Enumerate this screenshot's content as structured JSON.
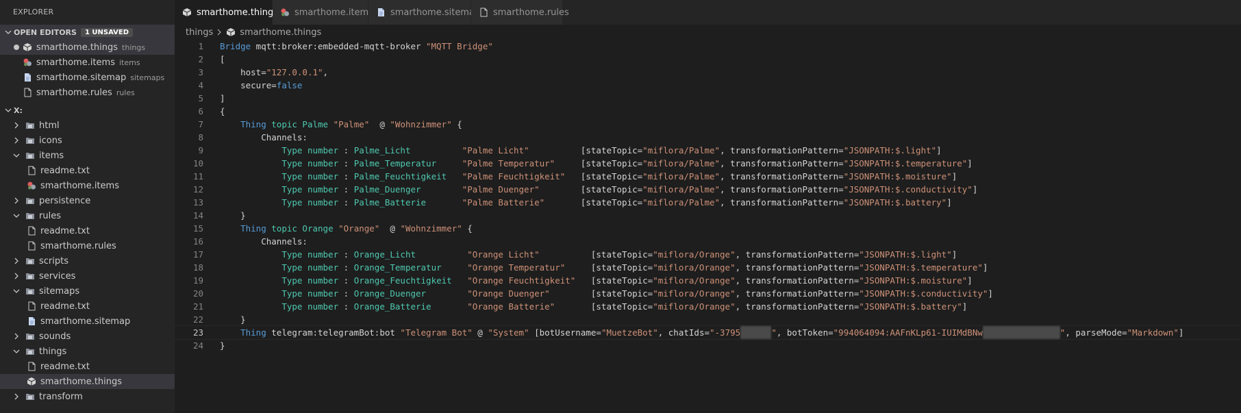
{
  "sidebar": {
    "title": "EXPLORER",
    "open_editors": {
      "label": "OPEN EDITORS",
      "badge": "1 UNSAVED",
      "items": [
        {
          "name": "smarthome.things",
          "desc": "things",
          "icon": "things-file-icon"
        },
        {
          "name": "smarthome.items",
          "desc": "items",
          "icon": "items-file-icon"
        },
        {
          "name": "smarthome.sitemap",
          "desc": "sitemaps",
          "icon": "sitemap-file-icon"
        },
        {
          "name": "smarthome.rules",
          "desc": "rules",
          "icon": "rules-file-icon"
        }
      ]
    },
    "workspace": {
      "label": "X:",
      "tree": [
        {
          "name": "html",
          "type": "folder",
          "expanded": false
        },
        {
          "name": "icons",
          "type": "folder",
          "expanded": false
        },
        {
          "name": "items",
          "type": "folder",
          "expanded": true
        },
        {
          "name": "readme.txt",
          "type": "file"
        },
        {
          "name": "smarthome.items",
          "type": "file"
        },
        {
          "name": "persistence",
          "type": "folder",
          "expanded": false
        },
        {
          "name": "rules",
          "type": "folder",
          "expanded": true
        },
        {
          "name": "readme.txt",
          "type": "file"
        },
        {
          "name": "smarthome.rules",
          "type": "file"
        },
        {
          "name": "scripts",
          "type": "folder",
          "expanded": false
        },
        {
          "name": "services",
          "type": "folder",
          "expanded": false
        },
        {
          "name": "sitemaps",
          "type": "folder",
          "expanded": true
        },
        {
          "name": "readme.txt",
          "type": "file"
        },
        {
          "name": "smarthome.sitemap",
          "type": "file"
        },
        {
          "name": "sounds",
          "type": "folder",
          "expanded": false
        },
        {
          "name": "things",
          "type": "folder",
          "expanded": true
        },
        {
          "name": "readme.txt",
          "type": "file"
        },
        {
          "name": "smarthome.things",
          "type": "file"
        },
        {
          "name": "transform",
          "type": "folder",
          "expanded": false
        }
      ]
    }
  },
  "tabs": [
    {
      "label": "smarthome.things",
      "active": true,
      "dirty": true
    },
    {
      "label": "smarthome.items",
      "active": false
    },
    {
      "label": "smarthome.sitemap",
      "active": false
    },
    {
      "label": "smarthome.rules",
      "active": false
    }
  ],
  "breadcrumb": {
    "folder": "things",
    "file": "smarthome.things"
  },
  "editor": {
    "current_line": 23,
    "lines": [
      [
        [
          "kw",
          "Bridge"
        ],
        [
          "pl",
          " mqtt:broker:embedded-mqtt-broker "
        ],
        [
          "st",
          "\"MQTT Bridge\""
        ]
      ],
      [
        [
          "pl",
          "["
        ]
      ],
      [
        [
          "pl",
          "    host="
        ],
        [
          "st",
          "\"127.0.0.1\""
        ],
        [
          "pl",
          ","
        ]
      ],
      [
        [
          "pl",
          "    secure="
        ],
        [
          "kw",
          "false"
        ]
      ],
      [
        [
          "pl",
          "]"
        ]
      ],
      [
        [
          "pl",
          "{"
        ]
      ],
      [
        [
          "pl",
          "    "
        ],
        [
          "kw",
          "Thing"
        ],
        [
          "pl",
          " "
        ],
        [
          "ty",
          "topic Palme"
        ],
        [
          "pl",
          " "
        ],
        [
          "st",
          "\"Palme\""
        ],
        [
          "pl",
          "  @ "
        ],
        [
          "st",
          "\"Wohnzimmer\""
        ],
        [
          "pl",
          " {"
        ]
      ],
      [
        [
          "pl",
          "        Channels:"
        ]
      ],
      [
        [
          "pl",
          "            "
        ],
        [
          "ty",
          "Type number"
        ],
        [
          "pl",
          " : "
        ],
        [
          "ty",
          "Palme_Licht"
        ],
        [
          "pl",
          "          "
        ],
        [
          "st",
          "\"Palme Licht\""
        ],
        [
          "pl",
          "          [stateTopic="
        ],
        [
          "st",
          "\"miflora/Palme\""
        ],
        [
          "pl",
          ", transformationPattern="
        ],
        [
          "st",
          "\"JSONPATH:$.light\""
        ],
        [
          "pl",
          "]"
        ]
      ],
      [
        [
          "pl",
          "            "
        ],
        [
          "ty",
          "Type number"
        ],
        [
          "pl",
          " : "
        ],
        [
          "ty",
          "Palme_Temperatur"
        ],
        [
          "pl",
          "     "
        ],
        [
          "st",
          "\"Palme Temperatur\""
        ],
        [
          "pl",
          "     [stateTopic="
        ],
        [
          "st",
          "\"miflora/Palme\""
        ],
        [
          "pl",
          ", transformationPattern="
        ],
        [
          "st",
          "\"JSONPATH:$.temperature\""
        ],
        [
          "pl",
          "]"
        ]
      ],
      [
        [
          "pl",
          "            "
        ],
        [
          "ty",
          "Type number"
        ],
        [
          "pl",
          " : "
        ],
        [
          "ty",
          "Palme_Feuchtigkeit"
        ],
        [
          "pl",
          "   "
        ],
        [
          "st",
          "\"Palme Feuchtigkeit\""
        ],
        [
          "pl",
          "   [stateTopic="
        ],
        [
          "st",
          "\"miflora/Palme\""
        ],
        [
          "pl",
          ", transformationPattern="
        ],
        [
          "st",
          "\"JSONPATH:$.moisture\""
        ],
        [
          "pl",
          "]"
        ]
      ],
      [
        [
          "pl",
          "            "
        ],
        [
          "ty",
          "Type number"
        ],
        [
          "pl",
          " : "
        ],
        [
          "ty",
          "Palme_Duenger"
        ],
        [
          "pl",
          "        "
        ],
        [
          "st",
          "\"Palme Duenger\""
        ],
        [
          "pl",
          "        [stateTopic="
        ],
        [
          "st",
          "\"miflora/Palme\""
        ],
        [
          "pl",
          ", transformationPattern="
        ],
        [
          "st",
          "\"JSONPATH:$.conductivity\""
        ],
        [
          "pl",
          "]"
        ]
      ],
      [
        [
          "pl",
          "            "
        ],
        [
          "ty",
          "Type number"
        ],
        [
          "pl",
          " : "
        ],
        [
          "ty",
          "Palme_Batterie"
        ],
        [
          "pl",
          "       "
        ],
        [
          "st",
          "\"Palme Batterie\""
        ],
        [
          "pl",
          "       [stateTopic="
        ],
        [
          "st",
          "\"miflora/Palme\""
        ],
        [
          "pl",
          ", transformationPattern="
        ],
        [
          "st",
          "\"JSONPATH:$.battery\""
        ],
        [
          "pl",
          "]"
        ]
      ],
      [
        [
          "pl",
          "    }"
        ]
      ],
      [
        [
          "pl",
          "    "
        ],
        [
          "kw",
          "Thing"
        ],
        [
          "pl",
          " "
        ],
        [
          "ty",
          "topic Orange"
        ],
        [
          "pl",
          " "
        ],
        [
          "st",
          "\"Orange\""
        ],
        [
          "pl",
          "  @ "
        ],
        [
          "st",
          "\"Wohnzimmer\""
        ],
        [
          "pl",
          " {"
        ]
      ],
      [
        [
          "pl",
          "        Channels:"
        ]
      ],
      [
        [
          "pl",
          "            "
        ],
        [
          "ty",
          "Type number"
        ],
        [
          "pl",
          " : "
        ],
        [
          "ty",
          "Orange_Licht"
        ],
        [
          "pl",
          "          "
        ],
        [
          "st",
          "\"Orange Licht\""
        ],
        [
          "pl",
          "          [stateTopic="
        ],
        [
          "st",
          "\"miflora/Orange\""
        ],
        [
          "pl",
          ", transformationPattern="
        ],
        [
          "st",
          "\"JSONPATH:$.light\""
        ],
        [
          "pl",
          "]"
        ]
      ],
      [
        [
          "pl",
          "            "
        ],
        [
          "ty",
          "Type number"
        ],
        [
          "pl",
          " : "
        ],
        [
          "ty",
          "Orange_Temperatur"
        ],
        [
          "pl",
          "     "
        ],
        [
          "st",
          "\"Orange Temperatur\""
        ],
        [
          "pl",
          "     [stateTopic="
        ],
        [
          "st",
          "\"miflora/Orange\""
        ],
        [
          "pl",
          ", transformationPattern="
        ],
        [
          "st",
          "\"JSONPATH:$.temperature\""
        ],
        [
          "pl",
          "]"
        ]
      ],
      [
        [
          "pl",
          "            "
        ],
        [
          "ty",
          "Type number"
        ],
        [
          "pl",
          " : "
        ],
        [
          "ty",
          "Orange_Feuchtigkeit"
        ],
        [
          "pl",
          "   "
        ],
        [
          "st",
          "\"Orange Feuchtigkeit\""
        ],
        [
          "pl",
          "   [stateTopic="
        ],
        [
          "st",
          "\"miflora/Orange\""
        ],
        [
          "pl",
          ", transformationPattern="
        ],
        [
          "st",
          "\"JSONPATH:$.moisture\""
        ],
        [
          "pl",
          "]"
        ]
      ],
      [
        [
          "pl",
          "            "
        ],
        [
          "ty",
          "Type number"
        ],
        [
          "pl",
          " : "
        ],
        [
          "ty",
          "Orange_Duenger"
        ],
        [
          "pl",
          "        "
        ],
        [
          "st",
          "\"Orange Duenger\""
        ],
        [
          "pl",
          "        [stateTopic="
        ],
        [
          "st",
          "\"miflora/Orange\""
        ],
        [
          "pl",
          ", transformationPattern="
        ],
        [
          "st",
          "\"JSONPATH:$.conductivity\""
        ],
        [
          "pl",
          "]"
        ]
      ],
      [
        [
          "pl",
          "            "
        ],
        [
          "ty",
          "Type number"
        ],
        [
          "pl",
          " : "
        ],
        [
          "ty",
          "Orange_Batterie"
        ],
        [
          "pl",
          "       "
        ],
        [
          "st",
          "\"Orange Batterie\""
        ],
        [
          "pl",
          "       [stateTopic="
        ],
        [
          "st",
          "\"miflora/Orange\""
        ],
        [
          "pl",
          ", transformationPattern="
        ],
        [
          "st",
          "\"JSONPATH:$.battery\""
        ],
        [
          "pl",
          "]"
        ]
      ],
      [
        [
          "pl",
          "    }"
        ]
      ],
      [
        [
          "pl",
          "    "
        ],
        [
          "kw",
          "Thing"
        ],
        [
          "pl",
          " telegram:telegramBot:bot "
        ],
        [
          "st",
          "\"Telegram Bot\""
        ],
        [
          "pl",
          " @ "
        ],
        [
          "st",
          "\"System\""
        ],
        [
          "pl",
          " [botUsername="
        ],
        [
          "st",
          "\"MuetzeBot\""
        ],
        [
          "pl",
          ", chatIds="
        ],
        [
          "st",
          "\"-3795"
        ],
        [
          "blur",
          "XXXXXX"
        ],
        [
          "st",
          "\""
        ],
        [
          "pl",
          ", botToken="
        ],
        [
          "st",
          "\"994064094:AAFnKLp61-IUIMdBNw"
        ],
        [
          "blur",
          "XXXXXXXXXXXXXXX"
        ],
        [
          "st",
          "\""
        ],
        [
          "pl",
          ", parseMode="
        ],
        [
          "st",
          "\"Markdown\""
        ],
        [
          "pl",
          "]"
        ]
      ],
      [
        [
          "pl",
          "}"
        ]
      ]
    ]
  }
}
